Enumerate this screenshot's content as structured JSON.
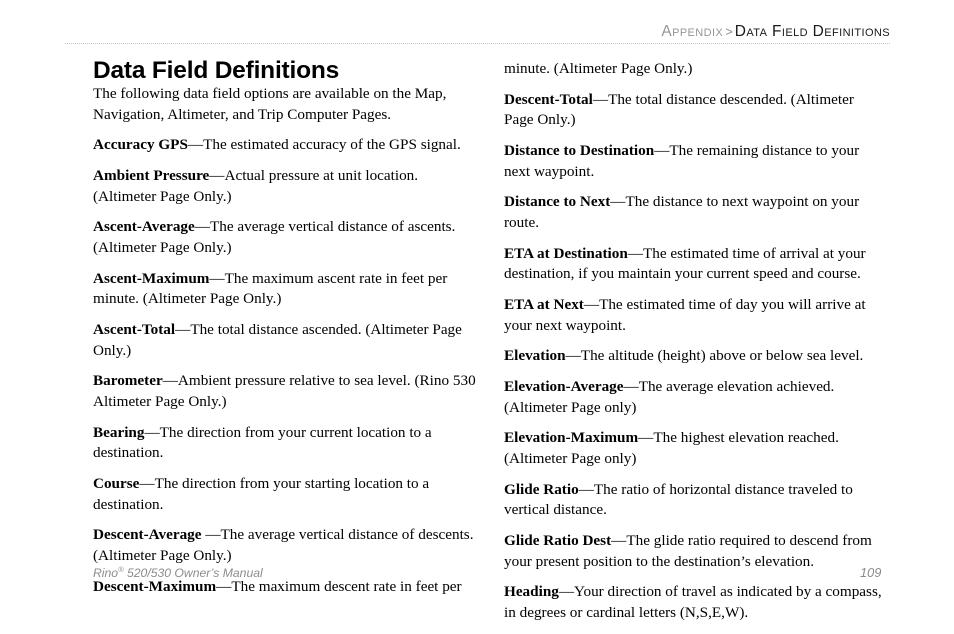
{
  "header": {
    "breadcrumb_parent": "Appendix",
    "breadcrumb_separator": ">",
    "breadcrumb_current": "Data Field Definitions",
    "muted_color": "#969696",
    "strong_color": "#1a1a1a",
    "rule_color": "#c3c3c3"
  },
  "page": {
    "title": "Data Field Definitions",
    "intro": "The following data field options are available on the Map, Navigation, Altimeter, and Trip Computer Pages."
  },
  "left_column": {
    "entries": [
      {
        "term": "Accuracy GPS",
        "definition": "—The estimated accuracy of the GPS signal."
      },
      {
        "term": "Ambient Pressure",
        "definition": "—Actual pressure at unit location. (Altimeter Page Only.)"
      },
      {
        "term": "Ascent-Average",
        "definition": "—The average vertical distance of ascents. (Altimeter Page Only.)"
      },
      {
        "term": "Ascent-Maximum",
        "definition": "—The maximum ascent rate in feet per minute. (Altimeter Page Only.)"
      },
      {
        "term": "Ascent-Total",
        "definition": "—The total distance ascended. (Altimeter Page Only.)"
      },
      {
        "term": "Barometer",
        "definition": "—Ambient pressure relative to sea level. (Rino 530 Altimeter Page Only.)"
      },
      {
        "term": "Bearing",
        "definition": "—The direction from your current location to a destination."
      },
      {
        "term": "Course",
        "definition": "—The direction from your starting location to a destination."
      },
      {
        "term": "Descent-Average",
        "definition": " —The average vertical distance of descents. (Altimeter Page Only.)"
      },
      {
        "term": "Descent-Maximum",
        "definition": "—The maximum descent rate in feet per"
      }
    ]
  },
  "right_column": {
    "continuation": "minute. (Altimeter Page Only.)",
    "entries": [
      {
        "term": "Descent-Total",
        "definition": "—The total distance descended. (Altimeter Page Only.)"
      },
      {
        "term": "Distance to Destination",
        "definition": "—The remaining distance to your next waypoint."
      },
      {
        "term": "Distance to Next",
        "definition": "—The distance to next waypoint on your route."
      },
      {
        "term": "ETA at Destination",
        "definition": "—The estimated time of arrival at your destination, if you maintain your current speed and course."
      },
      {
        "term": "ETA at Next",
        "definition": "—The estimated time of day you will arrive at your next waypoint."
      },
      {
        "term": "Elevation",
        "definition": "—The altitude (height) above or below sea level."
      },
      {
        "term": "Elevation-Average",
        "definition": "—The average elevation achieved. (Altimeter Page only)"
      },
      {
        "term": "Elevation-Maximum",
        "definition": "—The highest elevation reached. (Altimeter Page only)"
      },
      {
        "term": "Glide Ratio",
        "definition": "—The ratio of horizontal distance traveled to vertical distance."
      },
      {
        "term": "Glide Ratio Dest",
        "definition": "—The glide ratio required to descend from your present position to the destination’s elevation."
      },
      {
        "term": "Heading",
        "definition": "—Your direction of travel as indicated by a compass, in degrees or cardinal letters (N,S,E,W)."
      }
    ]
  },
  "footer": {
    "manual_name": "Rino",
    "manual_trademark": "®",
    "manual_rest": " 520/530 Owner’s Manual",
    "page_number": "109",
    "text_color": "#8c8c8c"
  }
}
